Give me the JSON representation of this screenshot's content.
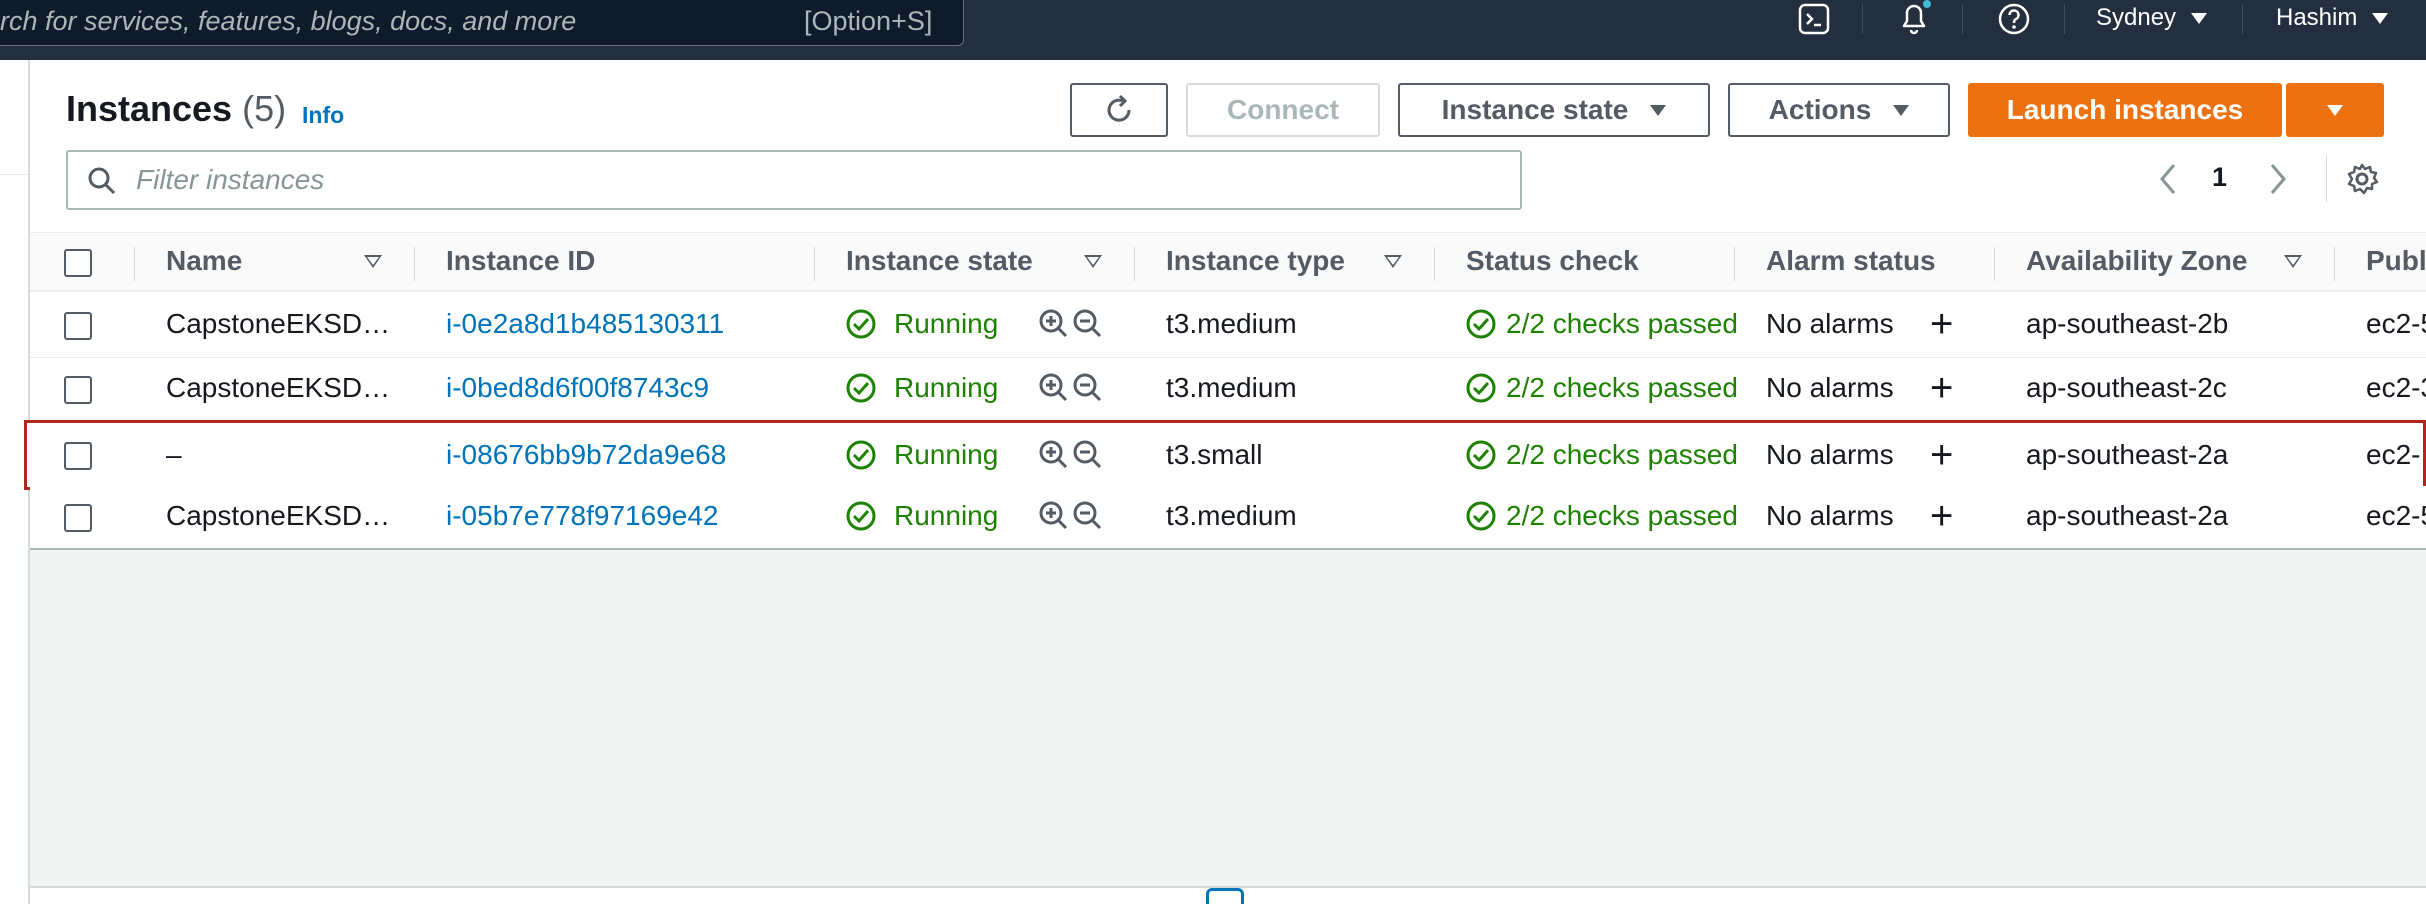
{
  "topnav": {
    "search_placeholder": "rch for services, features, blogs, docs, and more",
    "search_shortcut": "[Option+S]",
    "region": "Sydney",
    "user": "Hashim",
    "icons": [
      "cloudshell-icon",
      "bell-icon",
      "help-icon"
    ]
  },
  "header": {
    "title": "Instances",
    "count": "(5)",
    "info": "Info"
  },
  "toolbar": {
    "connect": "Connect",
    "instance_state": "Instance state",
    "actions": "Actions",
    "launch": "Launch instances"
  },
  "filter": {
    "placeholder": "Filter instances"
  },
  "pagination": {
    "page": "1"
  },
  "table": {
    "columns": {
      "name": "Name",
      "instance_id": "Instance ID",
      "instance_state": "Instance state",
      "instance_type": "Instance type",
      "status_check": "Status check",
      "alarm_status": "Alarm status",
      "availability_zone": "Availability Zone",
      "public": "Publ"
    },
    "rows": [
      {
        "name": "CapstoneEKSD…",
        "id": "i-0e2a8d1b485130311",
        "state": "Running",
        "type": "t3.medium",
        "status": "2/2 checks passed",
        "alarm": "No alarms",
        "az": "ap-southeast-2b",
        "public": "ec2-5"
      },
      {
        "name": "CapstoneEKSD…",
        "id": "i-0bed8d6f00f8743c9",
        "state": "Running",
        "type": "t3.medium",
        "status": "2/2 checks passed",
        "alarm": "No alarms",
        "az": "ap-southeast-2c",
        "public": "ec2-3"
      },
      {
        "name": "–",
        "id": "i-08676bb9b72da9e68",
        "state": "Running",
        "type": "t3.small",
        "status": "2/2 checks passed",
        "alarm": "No alarms",
        "az": "ap-southeast-2a",
        "public": "ec2-"
      },
      {
        "name": "CapstoneEKSD…",
        "id": "i-05b7e778f97169e42",
        "state": "Running",
        "type": "t3.medium",
        "status": "2/2 checks passed",
        "alarm": "No alarms",
        "az": "ap-southeast-2a",
        "public": "ec2-5"
      }
    ]
  },
  "colors": {
    "nav_bg": "#232f3e",
    "primary": "#ec7211",
    "link": "#0073bb",
    "success": "#1d8102",
    "highlight": "#b0271c"
  }
}
